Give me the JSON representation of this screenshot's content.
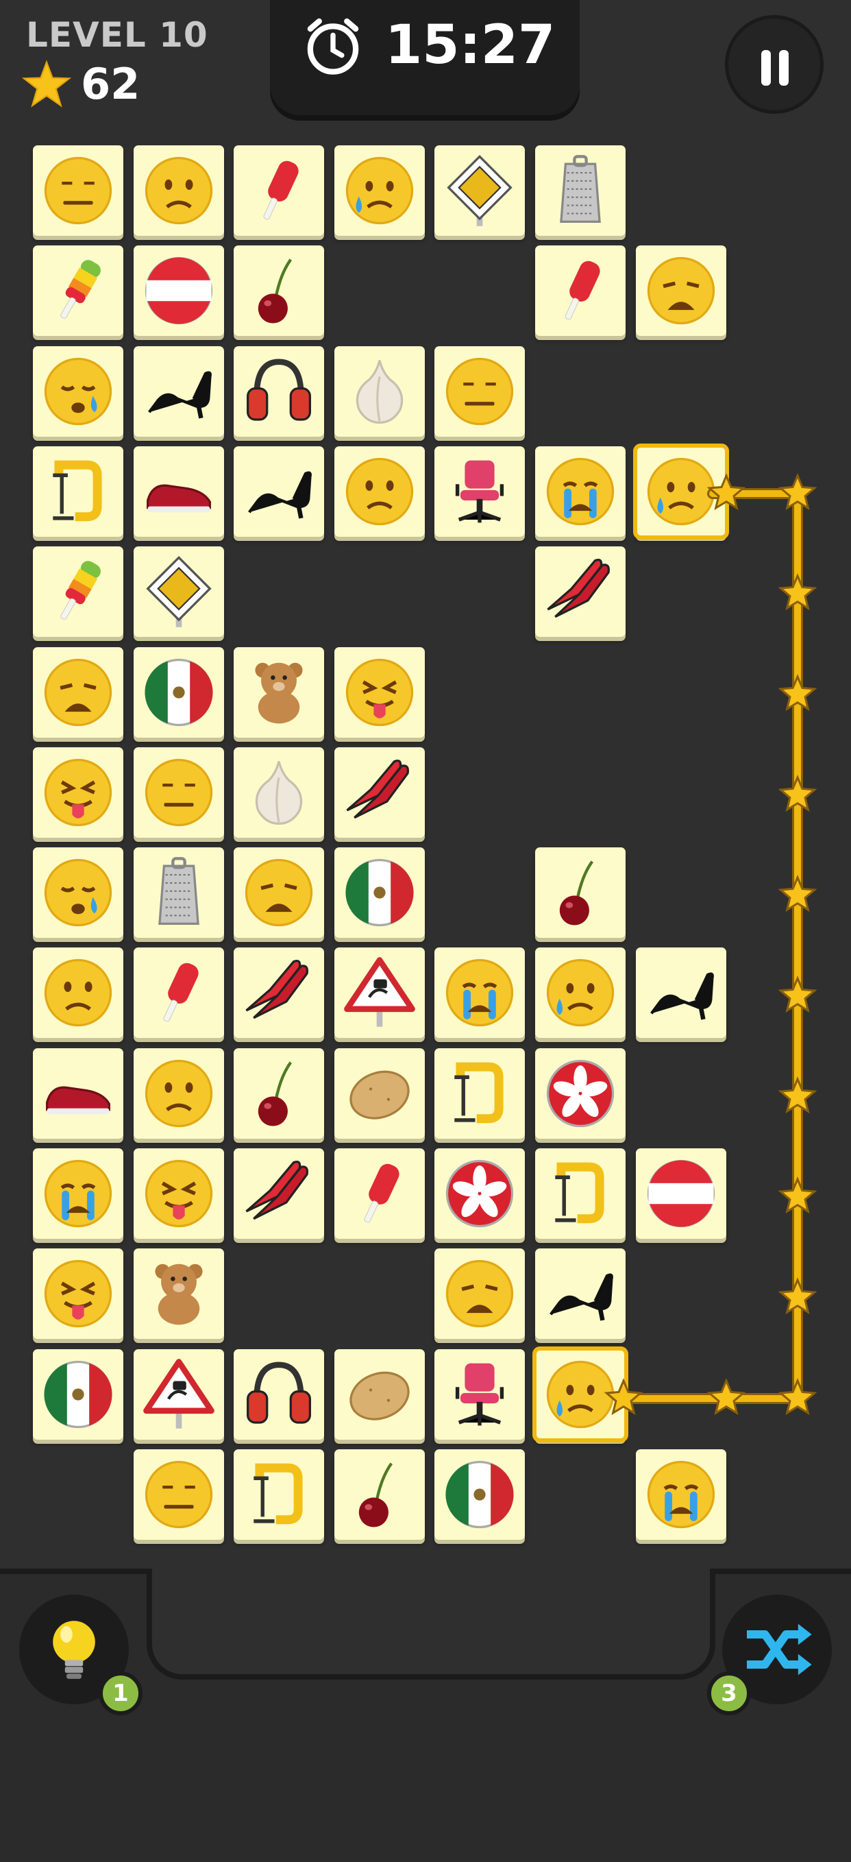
{
  "header": {
    "level_label": "LEVEL 10",
    "stars": "62",
    "timer": "15:27",
    "star_icon": "star-icon",
    "timer_icon": "stopwatch-icon",
    "pause_icon": "pause-icon"
  },
  "colors": {
    "background": "#2f2f2f",
    "tile": "#fdfbc9",
    "path": "#f0b90d",
    "badge": "#8cbc44",
    "shuffle": "#2fb6ee"
  },
  "board": {
    "rows": [
      [
        "neutral-face",
        "worried-face",
        "red-popsicle",
        "sad-sweat-face",
        "priority-road-sign",
        "cheese-grater",
        null,
        null
      ],
      [
        "rainbow-popsicle",
        "austria-flag",
        "cherry",
        null,
        null,
        "red-popsicle",
        "weary-face",
        null
      ],
      [
        "sleepy-face",
        "black-heel",
        "earmuffs",
        "garlic",
        "neutral-face",
        null,
        null,
        null
      ],
      [
        "c-clamp",
        "red-sneaker",
        "black-heel",
        "worried-face",
        "office-chair",
        "crying-face",
        "sad-sweat-face",
        null
      ],
      [
        "rainbow-popsicle",
        "priority-road-sign",
        null,
        null,
        null,
        "swim-fins",
        null,
        null
      ],
      [
        "weary-face",
        "mexico-flag",
        "teddy-bear",
        "tongue-face",
        null,
        null,
        null,
        null
      ],
      [
        "tongue-face",
        "neutral-face",
        "garlic",
        "swim-fins",
        null,
        null,
        null,
        null
      ],
      [
        "sleepy-face",
        "cheese-grater",
        "weary-face",
        "mexico-flag",
        null,
        "cherry",
        null,
        null
      ],
      [
        "worried-face",
        "red-popsicle",
        "swim-fins",
        "slippery-road-sign",
        "crying-face",
        "sad-sweat-face",
        "black-heel",
        null
      ],
      [
        "red-sneaker",
        "worried-face",
        "cherry",
        "potato",
        "c-clamp",
        "hong-kong-flag",
        null,
        null
      ],
      [
        "crying-face",
        "tongue-face",
        "swim-fins",
        "red-popsicle",
        "hong-kong-flag",
        "c-clamp",
        "austria-flag",
        null
      ],
      [
        "tongue-face",
        "teddy-bear",
        null,
        null,
        "weary-face",
        "black-heel",
        null,
        null
      ],
      [
        "mexico-flag",
        "slippery-road-sign",
        "earmuffs",
        "potato",
        "office-chair",
        "sad-sweat-face",
        null,
        null
      ],
      [
        null,
        "neutral-face",
        "c-clamp",
        "cherry",
        "mexico-flag",
        null,
        "crying-face",
        null
      ]
    ],
    "selected": [
      [
        3,
        6
      ],
      [
        12,
        5
      ]
    ]
  },
  "tools": {
    "hint_icon": "lightbulb-icon",
    "hint_count": "1",
    "shuffle_icon": "shuffle-icon",
    "shuffle_count": "3"
  }
}
